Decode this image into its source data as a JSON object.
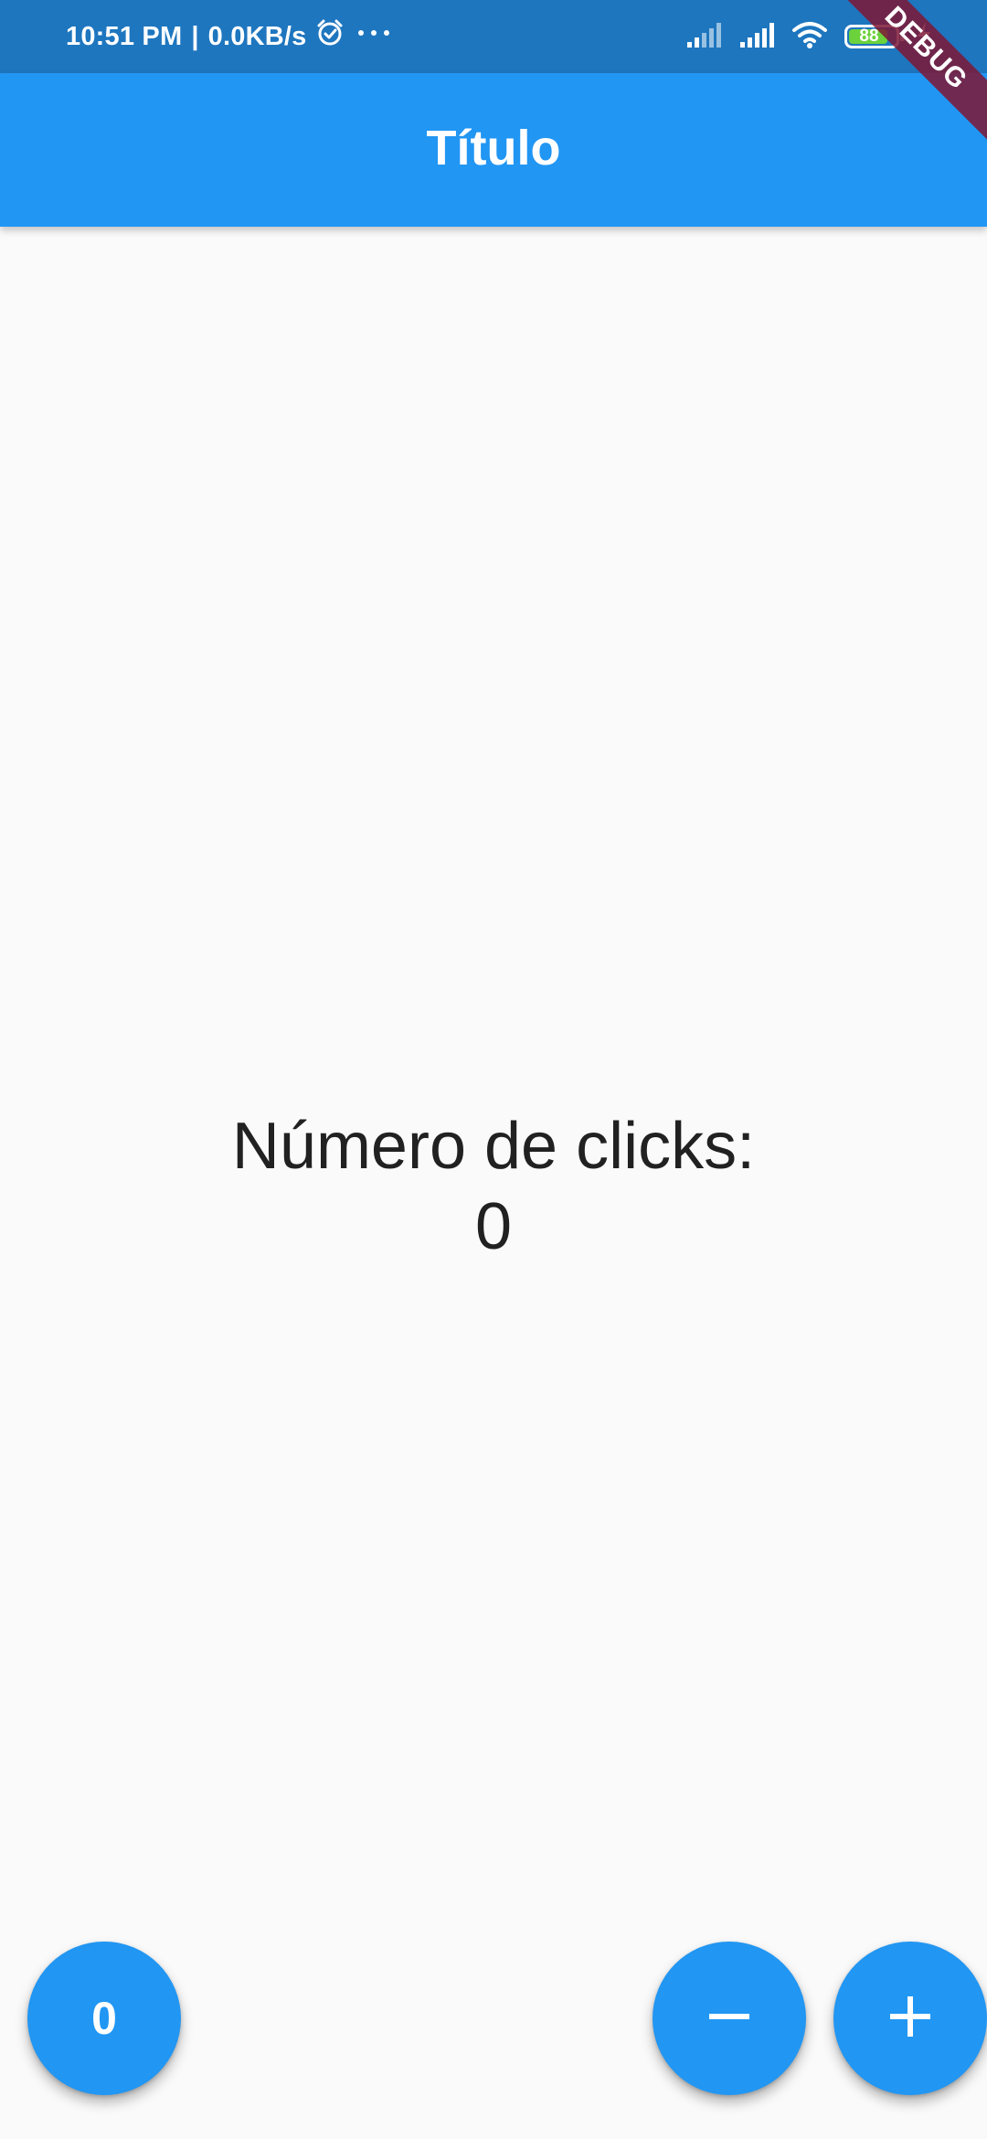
{
  "status_bar": {
    "time": "10:51 PM",
    "separator": "|",
    "network_speed": "0.0KB/s",
    "battery_level": "88",
    "icons": [
      "alarm-icon",
      "more-icon",
      "signal-icon",
      "signal-icon",
      "wifi-icon",
      "battery-icon",
      "charging-icon"
    ]
  },
  "app_bar": {
    "title": "Título"
  },
  "debug_banner": "DEBUG",
  "counter": {
    "label": "Número de clicks:",
    "value": "0"
  },
  "fab": {
    "reset_label": "0",
    "minus_icon": "minus-icon",
    "plus_icon": "plus-icon"
  },
  "colors": {
    "primary": "#2196f3",
    "status_bar": "#1e76bf",
    "background": "#fafafa",
    "text": "#212121",
    "debug_banner": "#7e1735"
  }
}
